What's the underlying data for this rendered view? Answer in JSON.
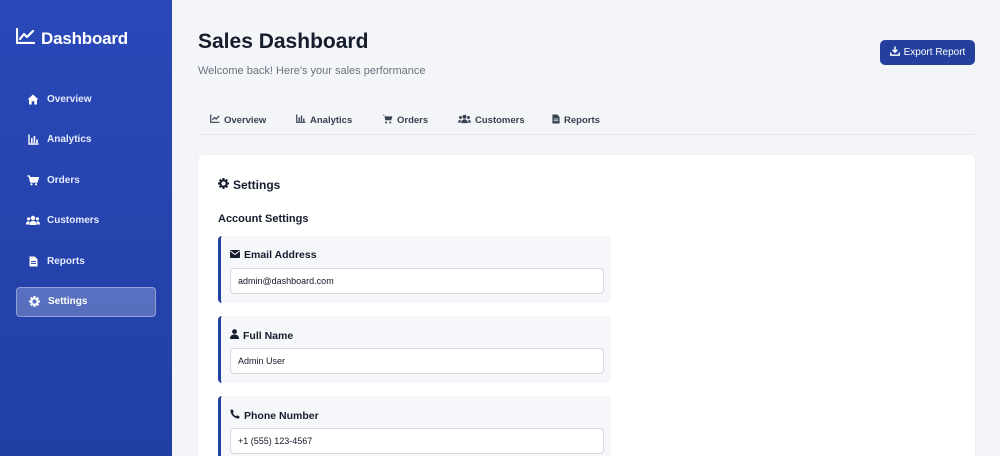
{
  "brand": {
    "title": "Dashboard",
    "icon": "chart-line-icon"
  },
  "sidebar": {
    "items": [
      {
        "label": "Overview",
        "icon": "home-icon"
      },
      {
        "label": "Analytics",
        "icon": "bar-chart-icon"
      },
      {
        "label": "Orders",
        "icon": "cart-icon"
      },
      {
        "label": "Customers",
        "icon": "users-icon"
      },
      {
        "label": "Reports",
        "icon": "file-icon"
      },
      {
        "label": "Settings",
        "icon": "gear-icon",
        "active": true
      }
    ]
  },
  "header": {
    "title": "Sales Dashboard",
    "subtitle": "Welcome back! Here's your sales performance",
    "export_label": "Export Report"
  },
  "tabs": [
    {
      "label": "Overview",
      "icon": "chart-line-icon"
    },
    {
      "label": "Analytics",
      "icon": "bar-chart-icon"
    },
    {
      "label": "Orders",
      "icon": "cart-icon"
    },
    {
      "label": "Customers",
      "icon": "users-icon"
    },
    {
      "label": "Reports",
      "icon": "file-icon"
    }
  ],
  "settings": {
    "title": "Settings",
    "section_title": "Account Settings",
    "fields": [
      {
        "label": "Email Address",
        "value": "admin@dashboard.com",
        "icon": "envelope-icon"
      },
      {
        "label": "Full Name",
        "value": "Admin User",
        "icon": "user-icon"
      },
      {
        "label": "Phone Number",
        "value": "+1 (555) 123-4567",
        "icon": "phone-icon"
      }
    ]
  },
  "colors": {
    "sidebar": "#2a48b8",
    "accent": "#24409f",
    "background": "#f3f5f8"
  }
}
